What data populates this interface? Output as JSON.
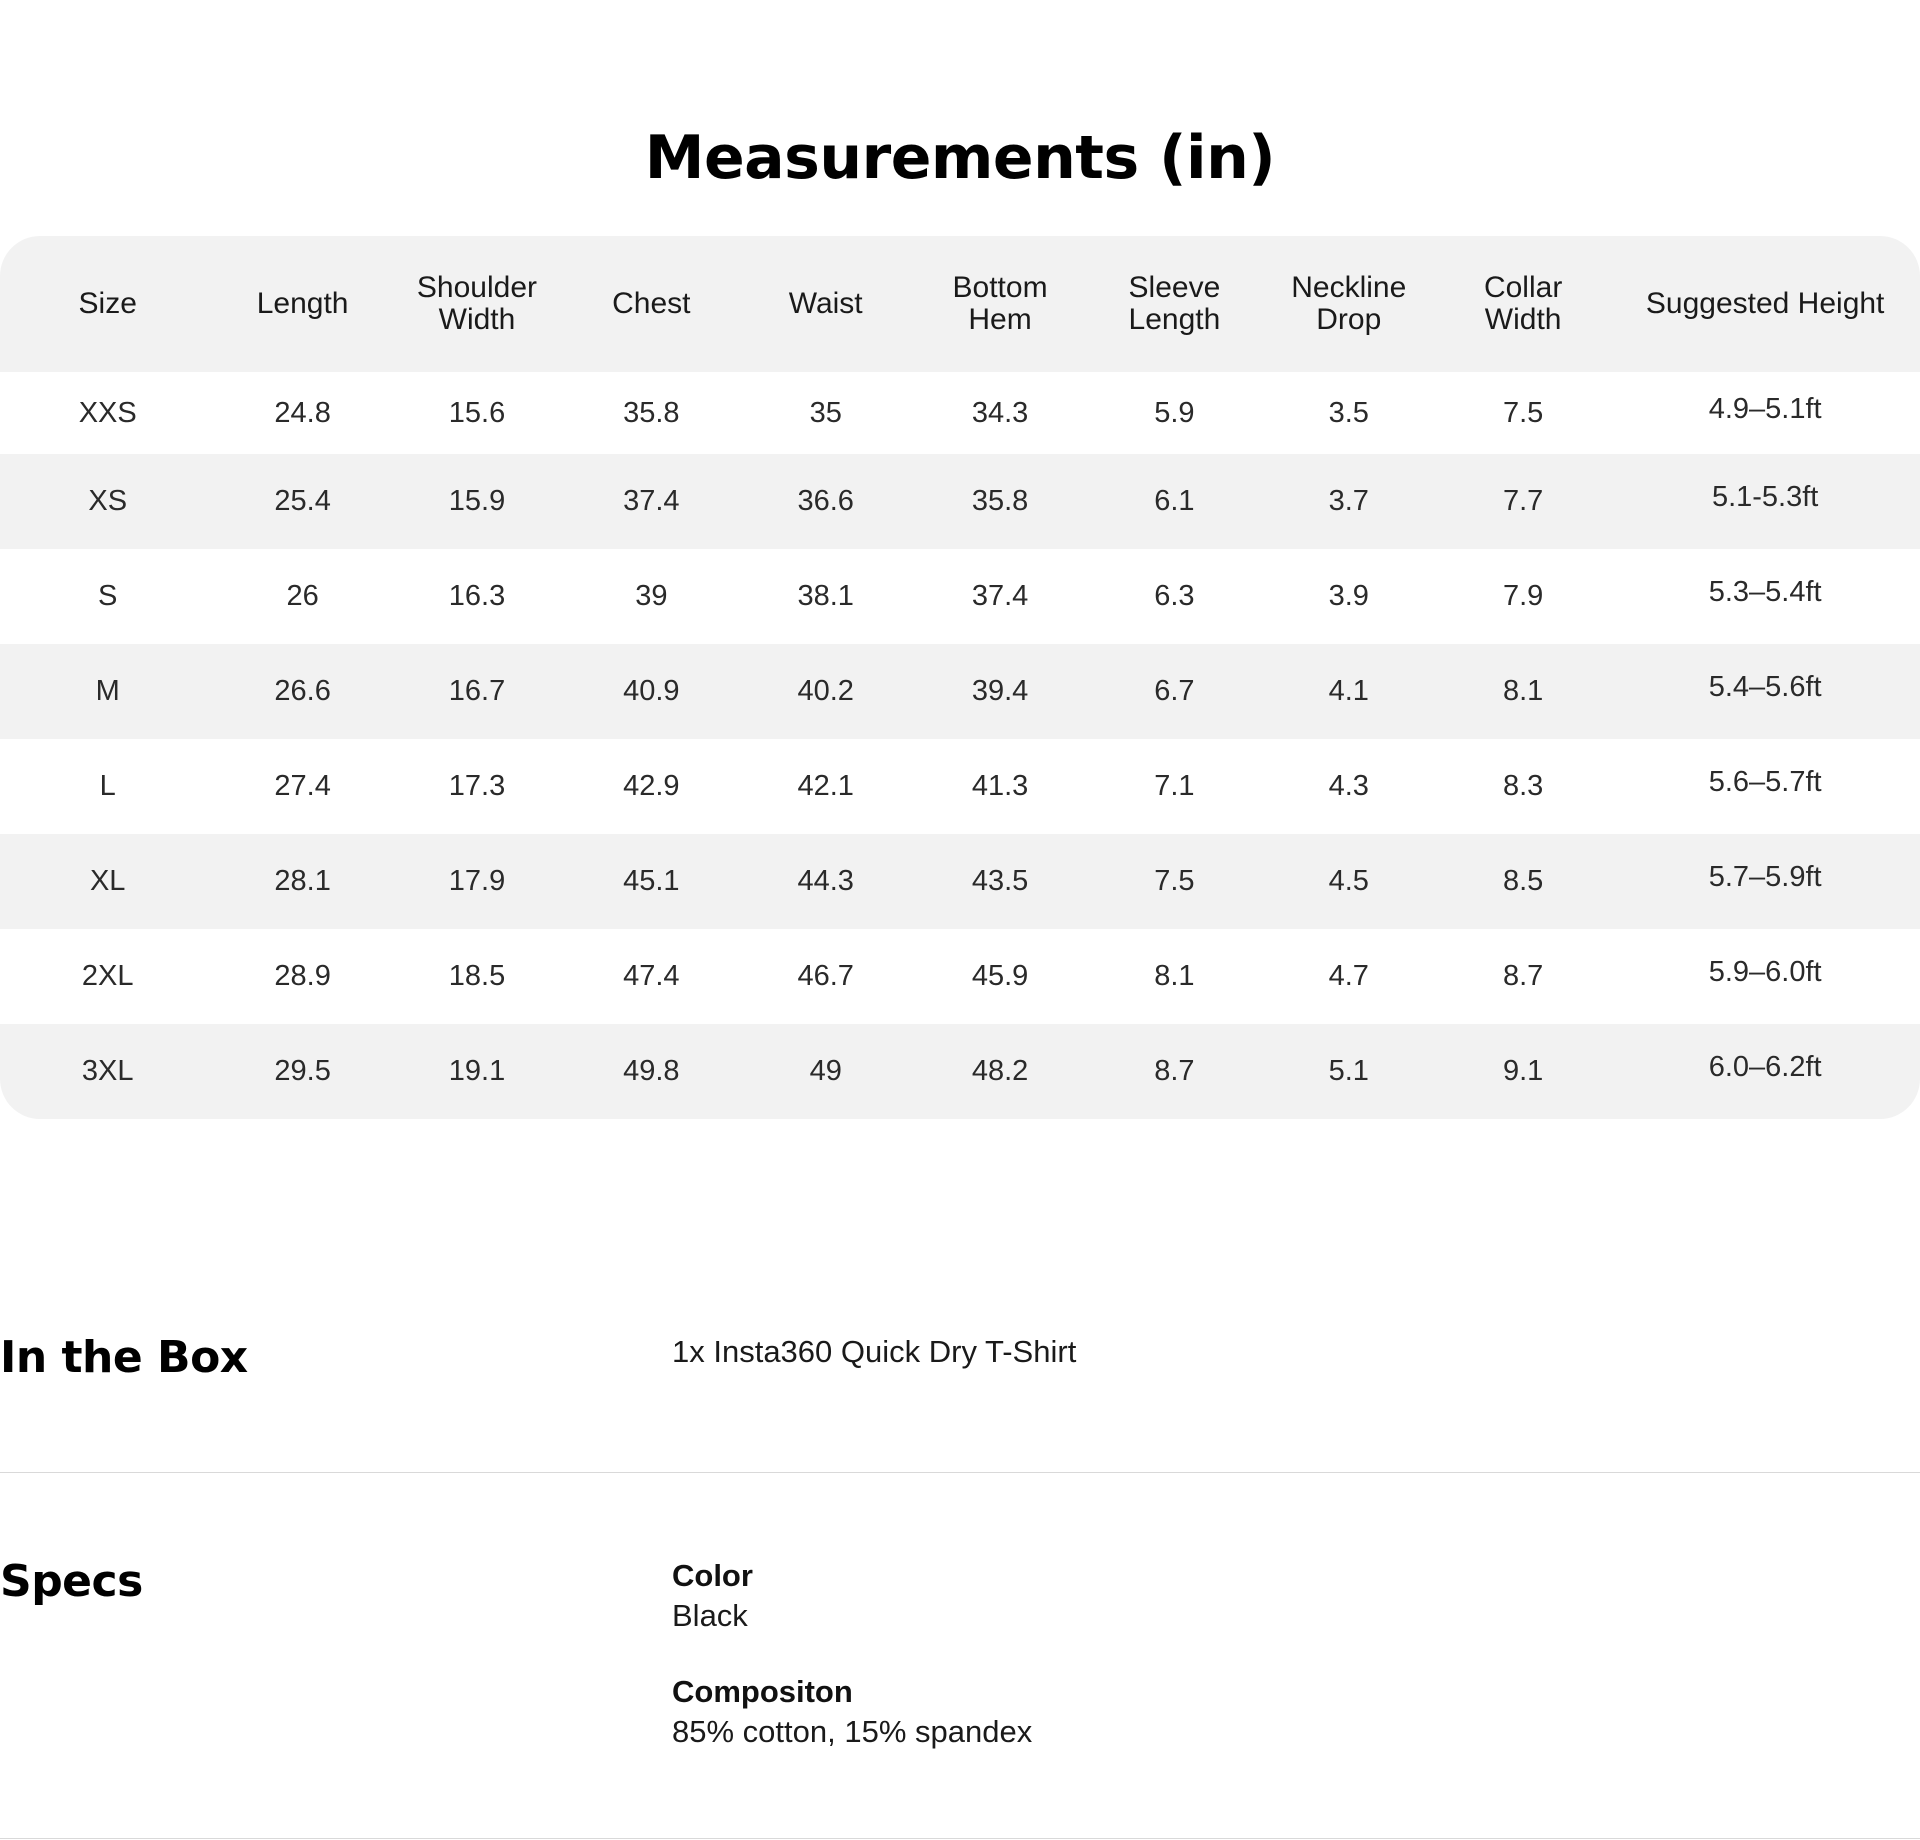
{
  "measurements": {
    "title": "Measurements (in)",
    "headers": [
      [
        "Size"
      ],
      [
        "Length"
      ],
      [
        "Shoulder",
        "Width"
      ],
      [
        "Chest"
      ],
      [
        "Waist"
      ],
      [
        "Bottom",
        "Hem"
      ],
      [
        "Sleeve",
        "Length"
      ],
      [
        "Neckline",
        "Drop"
      ],
      [
        "Collar",
        "Width"
      ],
      [
        "Suggested Height"
      ]
    ],
    "rows": [
      [
        "XXS",
        "24.8",
        "15.6",
        "35.8",
        "35",
        "34.3",
        "5.9",
        "3.5",
        "7.5",
        "4.9–5.1ft"
      ],
      [
        "XS",
        "25.4",
        "15.9",
        "37.4",
        "36.6",
        "35.8",
        "6.1",
        "3.7",
        "7.7",
        "5.1-5.3ft"
      ],
      [
        "S",
        "26",
        "16.3",
        "39",
        "38.1",
        "37.4",
        "6.3",
        "3.9",
        "7.9",
        "5.3–5.4ft"
      ],
      [
        "M",
        "26.6",
        "16.7",
        "40.9",
        "40.2",
        "39.4",
        "6.7",
        "4.1",
        "8.1",
        "5.4–5.6ft"
      ],
      [
        "L",
        "27.4",
        "17.3",
        "42.9",
        "42.1",
        "41.3",
        "7.1",
        "4.3",
        "8.3",
        "5.6–5.7ft"
      ],
      [
        "XL",
        "28.1",
        "17.9",
        "45.1",
        "44.3",
        "43.5",
        "7.5",
        "4.5",
        "8.5",
        "5.7–5.9ft"
      ],
      [
        "2XL",
        "28.9",
        "18.5",
        "47.4",
        "46.7",
        "45.9",
        "8.1",
        "4.7",
        "8.7",
        "5.9–6.0ft"
      ],
      [
        "3XL",
        "29.5",
        "19.1",
        "49.8",
        "49",
        "48.2",
        "8.7",
        "5.1",
        "9.1",
        "6.0–6.2ft"
      ]
    ]
  },
  "in_the_box": {
    "title": "In the Box",
    "content": "1x Insta360 Quick Dry T-Shirt"
  },
  "specs": {
    "title": "Specs",
    "items": [
      {
        "label": "Color",
        "value": "Black"
      },
      {
        "label": "Compositon",
        "value": "85% cotton, 15% spandex"
      }
    ]
  },
  "colors": {
    "header_bg": "#f2f2f2",
    "stripe_bg": "#f2f2f2",
    "divider": "#d9d9d9"
  }
}
